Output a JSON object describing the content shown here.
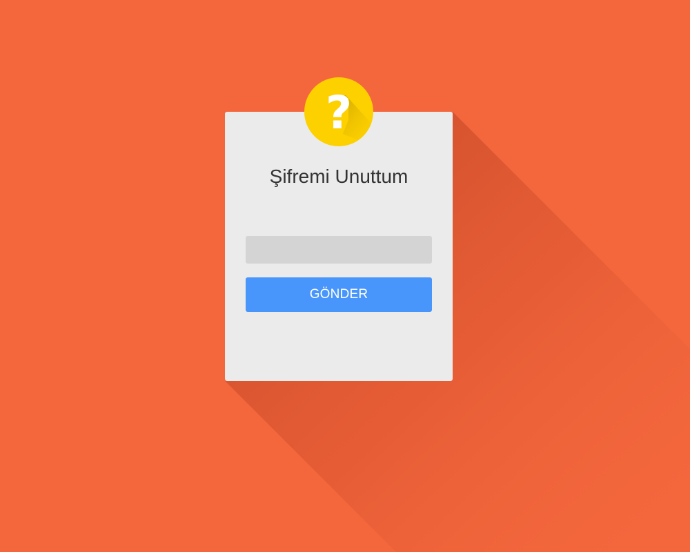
{
  "colors": {
    "background": "#f4673d",
    "card": "#ebebeb",
    "input": "#d4d4d4",
    "button": "#4895fb",
    "badge": "#fdd000",
    "title_text": "#333333",
    "button_text": "#ffffff"
  },
  "badge": {
    "icon": "question-mark-icon",
    "glyph": "?"
  },
  "form": {
    "title": "Şifremi Unuttum",
    "input_value": "",
    "input_placeholder": "",
    "submit_label": "GÖNDER"
  }
}
